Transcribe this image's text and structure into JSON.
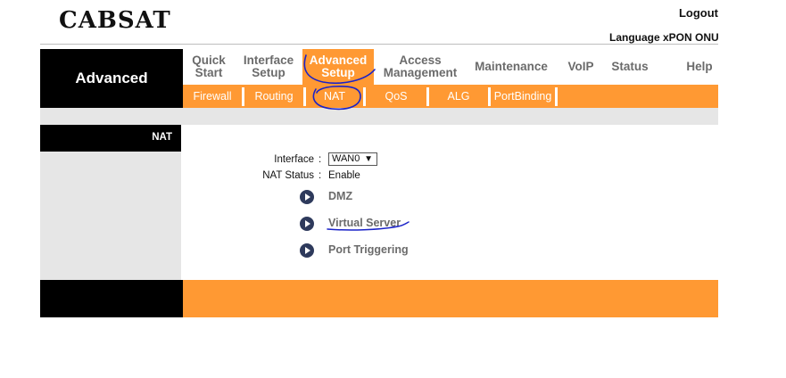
{
  "header": {
    "logo": "CABSAT",
    "logout": "Logout",
    "language_bar": "Language xPON ONU"
  },
  "section_title": "Advanced",
  "main_nav": [
    {
      "line1": "Quick",
      "line2": "Start"
    },
    {
      "line1": "Interface",
      "line2": "Setup"
    },
    {
      "line1": "Advanced",
      "line2": "Setup"
    },
    {
      "line1": "Access",
      "line2": "Management"
    },
    {
      "line1": "Maintenance",
      "line2": ""
    },
    {
      "line1": "VoIP",
      "line2": ""
    },
    {
      "line1": "Status",
      "line2": ""
    },
    {
      "line1": "Help",
      "line2": ""
    }
  ],
  "sub_nav": [
    "Firewall",
    "Routing",
    "NAT",
    "QoS",
    "ALG",
    "PortBinding"
  ],
  "left_panel": {
    "title": "NAT"
  },
  "form": {
    "interface_label": "Interface",
    "interface_value": "WAN0",
    "nat_status_label": "NAT Status",
    "nat_status_value": "Enable",
    "colon": ":"
  },
  "links": [
    "DMZ",
    "Virtual Server",
    "Port Triggering"
  ],
  "colors": {
    "accent": "#ff9933",
    "dark": "#000000",
    "panel_gray": "#e6e6e6",
    "bullet": "#2e3a5c",
    "annotation": "#1a22c8"
  }
}
